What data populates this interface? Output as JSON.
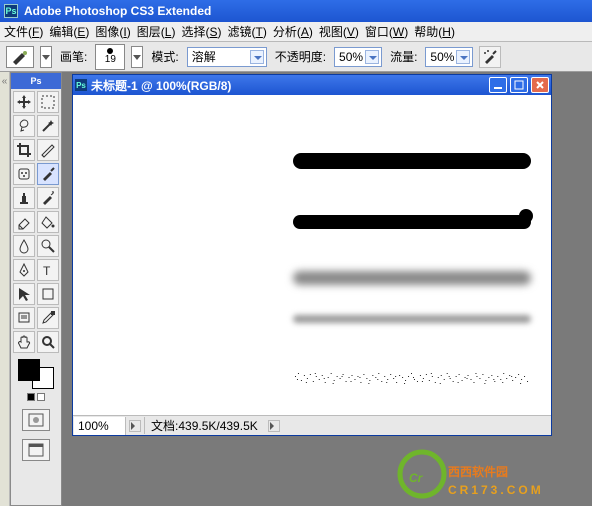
{
  "app_title": "Adobe Photoshop CS3 Extended",
  "menu": {
    "file": {
      "label": "文件",
      "hotkey": "F"
    },
    "edit": {
      "label": "编辑",
      "hotkey": "E"
    },
    "image": {
      "label": "图像",
      "hotkey": "I"
    },
    "layer": {
      "label": "图层",
      "hotkey": "L"
    },
    "select": {
      "label": "选择",
      "hotkey": "S"
    },
    "filter": {
      "label": "滤镜",
      "hotkey": "T"
    },
    "analysis": {
      "label": "分析",
      "hotkey": "A"
    },
    "view": {
      "label": "视图",
      "hotkey": "V"
    },
    "window": {
      "label": "窗口",
      "hotkey": "W"
    },
    "help": {
      "label": "帮助",
      "hotkey": "H"
    }
  },
  "options": {
    "brush_label": "画笔:",
    "brush_size": "19",
    "mode_label": "模式:",
    "mode_value": "溶解",
    "opacity_label": "不透明度:",
    "opacity_value": "50%",
    "flow_label": "流量:",
    "flow_value": "50%"
  },
  "document": {
    "title": "未标题-1 @ 100%(RGB/8)",
    "zoom": "100%",
    "status_label": "文档:",
    "status_value": "439.5K/439.5K"
  },
  "swatch": {
    "fg": "#000000",
    "bg": "#ffffff"
  },
  "watermark": {
    "site": "西西软件园",
    "url": "CR173.COM"
  }
}
